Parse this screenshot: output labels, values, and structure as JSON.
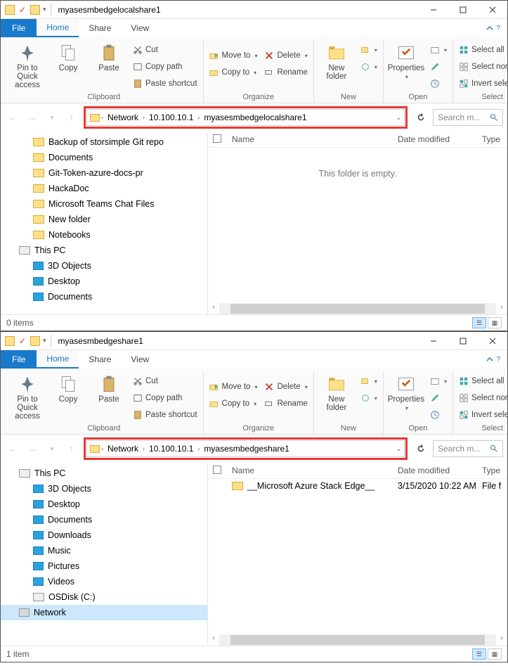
{
  "windows": [
    {
      "title": "myasesmbedgelocalshare1",
      "address": {
        "root": "Network",
        "ip": "10.100.10.1",
        "folder": "myasesmbedgelocalshare1"
      },
      "search_placeholder": "Search m...",
      "status": "0 items",
      "empty_message": "This folder is empty.",
      "columns": {
        "name": "Name",
        "date": "Date modified",
        "type": "Type"
      },
      "tree": [
        {
          "label": "Backup of storsimple Git repo",
          "icon": "folder",
          "indent": 2
        },
        {
          "label": "Documents",
          "icon": "folder",
          "indent": 2
        },
        {
          "label": "Git-Token-azure-docs-pr",
          "icon": "folder",
          "indent": 2
        },
        {
          "label": "HackaDoc",
          "icon": "folder",
          "indent": 2
        },
        {
          "label": "Microsoft Teams Chat Files",
          "icon": "folder",
          "indent": 2
        },
        {
          "label": "New folder",
          "icon": "folder",
          "indent": 2
        },
        {
          "label": "Notebooks",
          "icon": "folder",
          "indent": 2
        },
        {
          "label": "This PC",
          "icon": "pc",
          "indent": 1
        },
        {
          "label": "3D Objects",
          "icon": "blue",
          "indent": 2
        },
        {
          "label": "Desktop",
          "icon": "blue",
          "indent": 2
        },
        {
          "label": "Documents",
          "icon": "blue",
          "indent": 2
        }
      ],
      "files": []
    },
    {
      "title": "myasesmbedgeshare1",
      "address": {
        "root": "Network",
        "ip": "10.100.10.1",
        "folder": "myasesmbedgeshare1"
      },
      "search_placeholder": "Search m...",
      "status": "1 item",
      "columns": {
        "name": "Name",
        "date": "Date modified",
        "type": "Type"
      },
      "tree": [
        {
          "label": "This PC",
          "icon": "pc",
          "indent": 1
        },
        {
          "label": "3D Objects",
          "icon": "blue",
          "indent": 2
        },
        {
          "label": "Desktop",
          "icon": "blue",
          "indent": 2
        },
        {
          "label": "Documents",
          "icon": "blue",
          "indent": 2
        },
        {
          "label": "Downloads",
          "icon": "blue",
          "indent": 2
        },
        {
          "label": "Music",
          "icon": "blue",
          "indent": 2
        },
        {
          "label": "Pictures",
          "icon": "blue",
          "indent": 2
        },
        {
          "label": "Videos",
          "icon": "blue",
          "indent": 2
        },
        {
          "label": "OSDisk (C:)",
          "icon": "pc",
          "indent": 2
        },
        {
          "label": "Network",
          "icon": "net",
          "indent": 1,
          "sel": true
        }
      ],
      "files": [
        {
          "name": "__Microsoft Azure Stack Edge__",
          "date": "3/15/2020 10:22 AM",
          "type": "File f"
        }
      ]
    }
  ],
  "ribbon": {
    "tabs": {
      "file": "File",
      "home": "Home",
      "share": "Share",
      "view": "View"
    },
    "clipboard": {
      "label": "Clipboard",
      "pin": "Pin to Quick access",
      "copy": "Copy",
      "paste": "Paste",
      "cut": "Cut",
      "copy_path": "Copy path",
      "paste_shortcut": "Paste shortcut"
    },
    "organize": {
      "label": "Organize",
      "move_to": "Move to",
      "copy_to": "Copy to",
      "delete": "Delete",
      "rename": "Rename"
    },
    "new_group": {
      "label": "New",
      "new_folder": "New folder"
    },
    "open_group": {
      "label": "Open",
      "properties": "Properties"
    },
    "select": {
      "label": "Select",
      "all": "Select all",
      "none": "Select none",
      "invert": "Invert selection"
    }
  }
}
